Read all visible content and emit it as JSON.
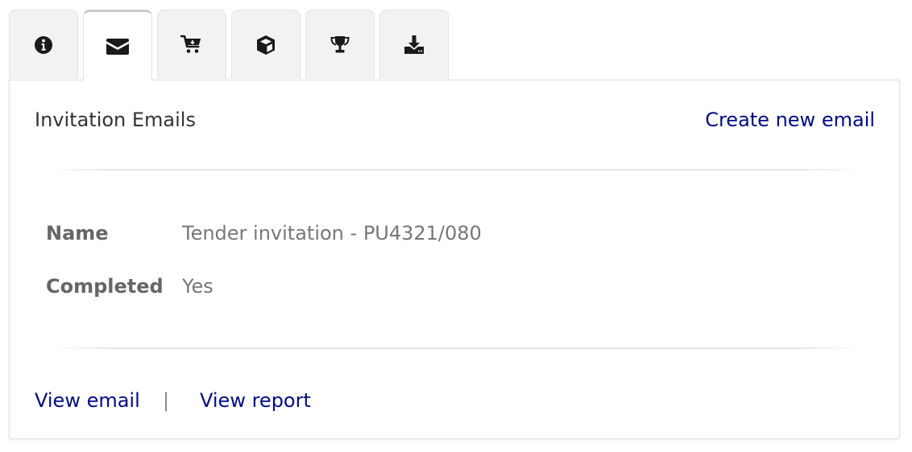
{
  "tabs": [
    {
      "icon": "info-icon",
      "active": false
    },
    {
      "icon": "envelope-icon",
      "active": true
    },
    {
      "icon": "cart-icon",
      "active": false
    },
    {
      "icon": "cube-icon",
      "active": false
    },
    {
      "icon": "trophy-icon",
      "active": false
    },
    {
      "icon": "download-icon",
      "active": false
    }
  ],
  "panel": {
    "title": "Invitation Emails",
    "create_link": "Create new email",
    "fields": [
      {
        "label": "Name",
        "value": "Tender invitation - PU4321/080"
      },
      {
        "label": "Completed",
        "value": "Yes"
      }
    ],
    "actions": {
      "view_email": "View email",
      "separator": "|",
      "view_report": "View report"
    }
  },
  "colors": {
    "link": "#000a85",
    "tab_bg": "#f2f2f2",
    "label": "#666666",
    "value": "#777777"
  }
}
